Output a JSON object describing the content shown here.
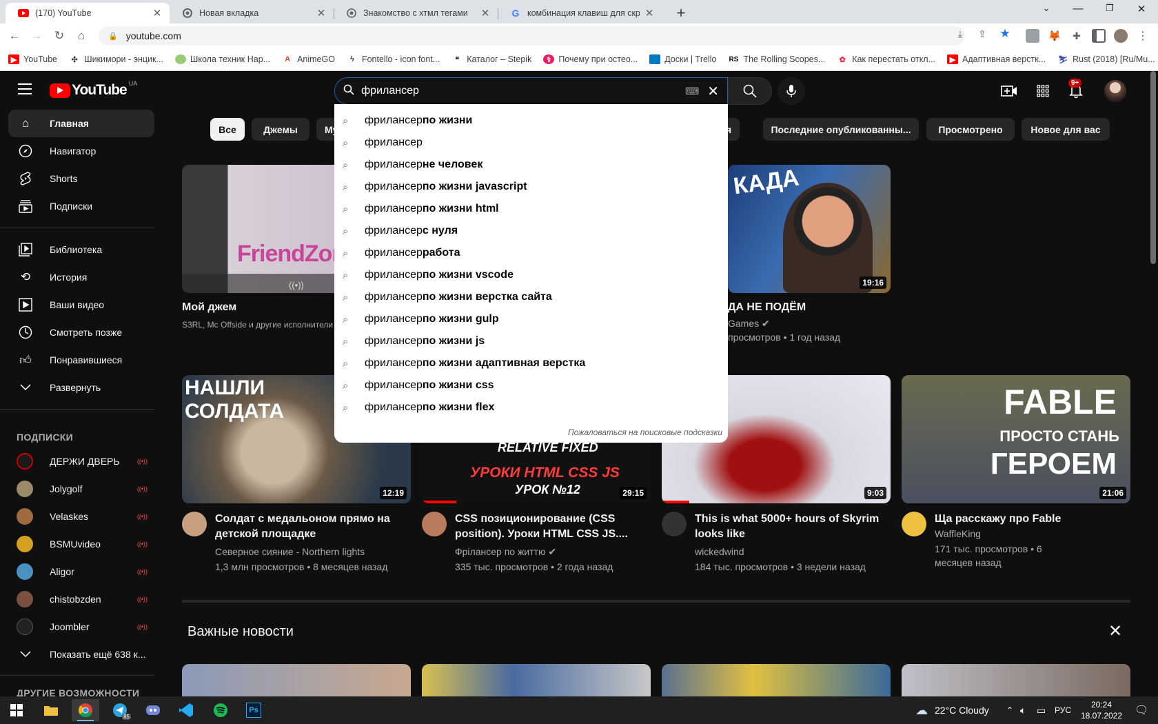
{
  "browser": {
    "tabs": [
      {
        "title": "(170) YouTube",
        "active": true
      },
      {
        "title": "Новая вкладка",
        "active": false
      },
      {
        "title": "Знакомство с хтмл тегами",
        "active": false
      },
      {
        "title": "комбинация клавиш для скрин",
        "active": false
      }
    ],
    "url": "youtube.com",
    "bookmarks": [
      "YouTube",
      "Шикимори - энцик...",
      "Школа техник Нар...",
      "AnimeGO",
      "Fontello - icon font...",
      "Каталог – Stepik",
      "Почему при остео...",
      "Доски | Trello",
      "The Rolling Scopes...",
      "Как перестать откл...",
      "Адаптивная верстк...",
      "Rust (2018) [Ru/Mu..."
    ]
  },
  "masthead": {
    "logo_text": "YouTube",
    "region": "UA",
    "search_value": "фрилансер",
    "notif_badge": "9+"
  },
  "suggestions": {
    "prefix": "фрилансер",
    "items": [
      " по жизни",
      "",
      " не человек",
      " по жизни javascript",
      " по жизни html",
      " с нуля",
      " работа",
      " по жизни vscode",
      " по жизни верстка сайта",
      " по жизни gulp",
      " по жизни js",
      " по жизни адаптивная верстка",
      " по жизни css",
      " по жизни flex"
    ],
    "report": "Пожаловаться на поисковые подсказки"
  },
  "sidebar": {
    "main": [
      "Главная",
      "Навигатор",
      "Shorts",
      "Подписки"
    ],
    "library": [
      "Библиотека",
      "История",
      "Ваши видео",
      "Смотреть позже",
      "Понравившиеся",
      "Развернуть"
    ],
    "subs_heading": "ПОДПИСКИ",
    "subs": [
      "ДЕРЖИ ДВЕРЬ",
      "Jolygolf",
      "Velaskes",
      "BSMUvideo",
      "Aligor",
      "chistobzden",
      "Joombler"
    ],
    "show_more": "Показать ещё 638 к...",
    "features_heading": "ДРУГИЕ ВОЗМОЖНОСТИ"
  },
  "chips": {
    "all": "Все",
    "jams": "Джемы",
    "mu": "Му",
    "ria": "рия",
    "latest": "Последние опубликованны...",
    "watched": "Просмотрено",
    "new": "Новое для вас"
  },
  "row1": {
    "mix_title": "Мой джем",
    "mix_sub": "S3RL, Mc Offside и другие исполнители",
    "v4_duration": "19:16",
    "v4_title_part": "ДА НЕ ПОДЁМ",
    "v4_channel_part": "Games",
    "v4_meta_part": "просмотров • 1 год назад"
  },
  "row2": [
    {
      "title": "Солдат с медальоном прямо на детской площадке",
      "channel": "Северное сияние - Northern lights",
      "meta": "1,3 млн просмотров • 8 месяцев назад",
      "duration": "12:19"
    },
    {
      "title": "CSS позиционирование (CSS position). Уроки HTML CSS JS....",
      "channel": "Фрілансер по життю",
      "meta": "335 тыс. просмотров • 2 года назад",
      "duration": "29:15"
    },
    {
      "title": "This is what 5000+ hours of Skyrim looks like",
      "channel": "wickedwind",
      "meta": "184 тыс. просмотров • 3 недели назад",
      "duration": "9:03"
    },
    {
      "title": "Ща расскажу про Fable",
      "channel": "WaffleKing",
      "meta": "171 тыс. просмотров • 6 месяцев назад",
      "duration": "21:06"
    }
  ],
  "news": {
    "title": "Важные новости"
  },
  "taskbar": {
    "weather": "22°C  Cloudy",
    "lang": "РУС",
    "time": "20:24",
    "date": "18.07.2022",
    "telegram_badge": "85"
  }
}
